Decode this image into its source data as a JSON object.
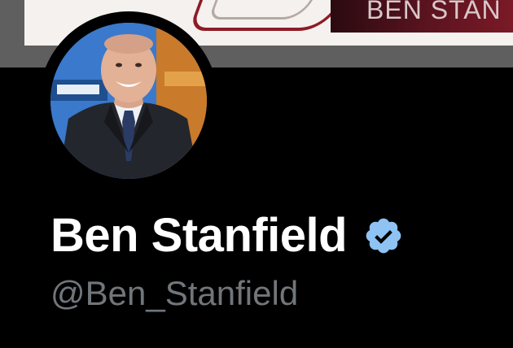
{
  "profile": {
    "display_name": "Ben Stanfield",
    "handle": "@Ben_Stanfield",
    "verified": true,
    "avatar": "profile-photo"
  },
  "banner": {
    "brand_text": "BEN STAN"
  },
  "colors": {
    "background": "#000000",
    "name": "#ffffff",
    "handle": "#71767b",
    "verified_badge": "#8ec3f4",
    "banner_frame": "#5f5f5f"
  },
  "icons": {
    "verified": "verified-badge-icon"
  }
}
